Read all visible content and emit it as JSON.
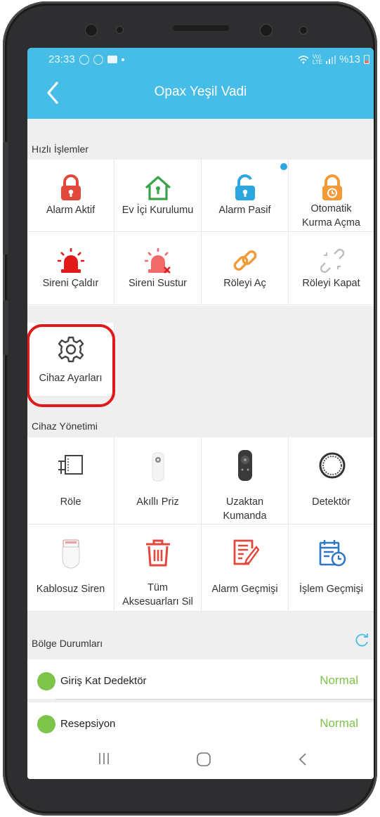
{
  "status_bar": {
    "time": "23:33",
    "battery": "%13"
  },
  "header": {
    "title": "Opax Yeşil Vadi"
  },
  "quick_actions": {
    "section_title": "Hızlı İşlemler",
    "items": [
      {
        "label": "Alarm Aktif",
        "icon": "lock-closed-icon",
        "color": "#e2473c"
      },
      {
        "label": "Ev İçi Kurulumu",
        "icon": "home-lock-icon",
        "color": "#3aa34a"
      },
      {
        "label": "Alarm Pasif",
        "icon": "lock-open-icon",
        "color": "#2ba6de"
      },
      {
        "label": "Otomatik Kurma Açma",
        "label_line1": "Otomatik",
        "label_line2": "Kurma Açma",
        "icon": "lock-timer-icon",
        "color": "#f29a38"
      },
      {
        "label": "Sireni Çaldır",
        "icon": "siren-icon",
        "color": "#e2191b"
      },
      {
        "label": "Sireni Sustur",
        "icon": "siren-mute-icon",
        "color": "#f06a6a"
      },
      {
        "label": "Röleyi Aç",
        "icon": "link-icon",
        "color": "#f29a38"
      },
      {
        "label": "Röleyi Kapat",
        "icon": "link-broken-icon",
        "color": "#bdbdbd"
      },
      {
        "label": "Cihaz Ayarları",
        "icon": "gear-icon",
        "color": "#444444"
      }
    ]
  },
  "device_management": {
    "section_title": "Cihaz Yönetimi",
    "items": [
      {
        "label": "Röle",
        "icon": "relay-icon"
      },
      {
        "label": "Akıllı Priz",
        "icon": "smart-plug-icon"
      },
      {
        "label": "Uzaktan Kumanda",
        "label_line1": "Uzaktan",
        "label_line2": "Kumanda",
        "icon": "remote-control-icon"
      },
      {
        "label": "Detektör",
        "icon": "detector-icon"
      },
      {
        "label": "Kablosuz Siren",
        "icon": "wireless-siren-icon"
      },
      {
        "label": "Tüm Aksesuarları Sil",
        "label_line1": "Tüm",
        "label_line2": "Aksesuarları Sil",
        "icon": "trash-icon",
        "color": "#e2473c"
      },
      {
        "label": "Alarm Geçmişi",
        "icon": "alarm-history-icon",
        "color": "#e2473c"
      },
      {
        "label": "İşlem Geçmişi",
        "icon": "calendar-clock-icon",
        "color": "#2e76c6"
      }
    ]
  },
  "zones": {
    "section_title": "Bölge Durumları",
    "items": [
      {
        "name": "Giriş Kat Dedektör",
        "status": "Normal"
      },
      {
        "name": "Resepsiyon",
        "status": "Normal"
      }
    ],
    "status_color": "#7dc44a"
  },
  "colors": {
    "appbar": "#45bde6",
    "highlight": "#e2191b"
  }
}
